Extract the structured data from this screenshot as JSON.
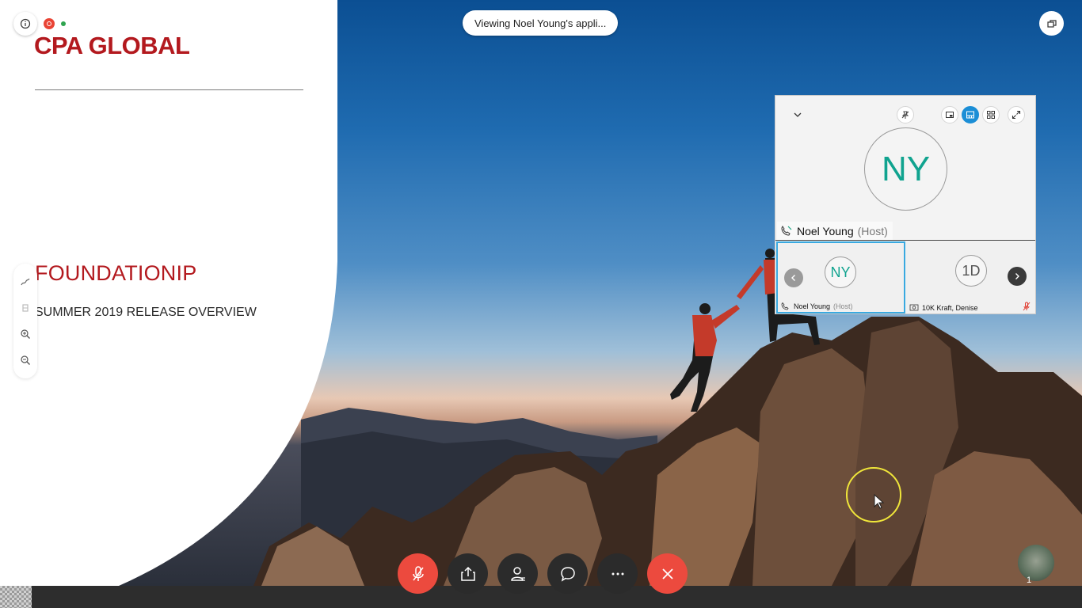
{
  "presentation": {
    "brand": "CPA GLOBAL",
    "product": "FOUNDATIONIP",
    "subtitle": "SUMMER 2019 RELEASE OVERVIEW"
  },
  "toast": {
    "text": "Viewing Noel Young's appli..."
  },
  "participants": {
    "active_speaker": {
      "initials": "NY",
      "name": "Noel Young",
      "role": "(Host)"
    },
    "thumbnails": [
      {
        "initials": "NY",
        "name": "Noel Young",
        "role": "(Host)"
      },
      {
        "initials": "1D",
        "name": "10K Kraft, Denise",
        "role": ""
      }
    ]
  },
  "controls": {
    "mute": "microphone-muted-icon",
    "share": "share-icon",
    "participants": "participants-icon",
    "chat": "chat-icon",
    "more": "more-icon",
    "leave": "leave-icon"
  },
  "corner_badge": {
    "count": "1"
  },
  "colors": {
    "brand_red": "#b3191e",
    "avatar_teal": "#10a38f",
    "control_red": "#ec4a3e",
    "control_dark": "#2b2b2b",
    "active_blue": "#1b8ed6",
    "cursor_yellow": "#f0e63a"
  }
}
